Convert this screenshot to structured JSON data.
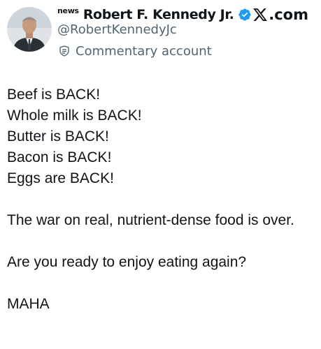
{
  "author": {
    "news_badge": "news",
    "display_name": "Robert F. Kennedy Jr.",
    "handle": "@RobertKennedyJc",
    "account_label": "Commentary account",
    "verified": true
  },
  "brand": {
    "site": ".com",
    "logo_icon": "x-logo-icon"
  },
  "tweet": {
    "lines": [
      "Beef is BACK!",
      "Whole milk is BACK!",
      "Butter is BACK!",
      "Bacon is BACK!",
      "Eggs are BACK!"
    ],
    "paragraph_1": "The war on real, nutrient-dense food is over.",
    "paragraph_2": "Are you ready to enjoy eating again?",
    "signoff": "MAHA"
  },
  "colors": {
    "text_primary": "#0f1419",
    "text_secondary": "#536471",
    "verified_blue": "#1d9bf0"
  }
}
